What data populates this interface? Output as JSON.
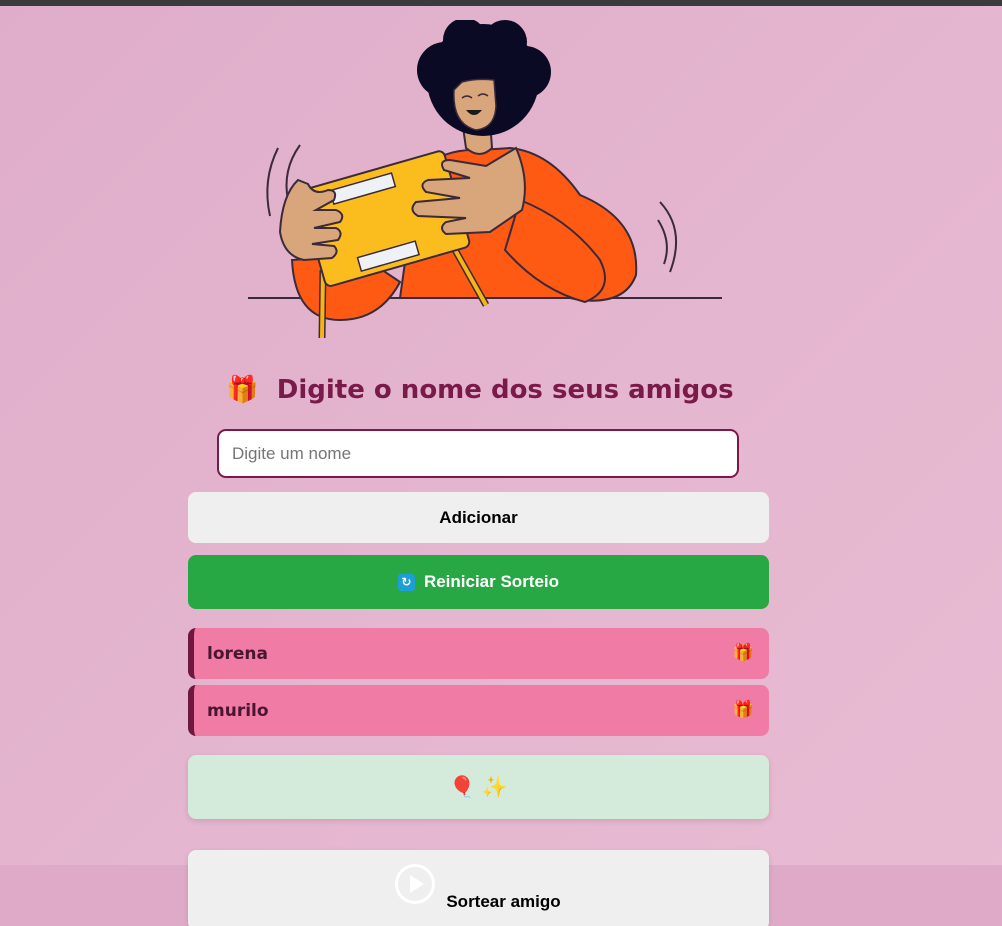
{
  "title": {
    "emoji": "🎁",
    "text": "Digite o nome dos seus amigos"
  },
  "input": {
    "placeholder": "Digite um nome",
    "value": ""
  },
  "buttons": {
    "add_label": "Adicionar",
    "reset_icon": "🔄",
    "reset_label": "Reiniciar Sorteio",
    "draw_label": "Sortear amigo",
    "draw_icon": "play-icon"
  },
  "friends": [
    {
      "name": "lorena",
      "icon": "🎁"
    },
    {
      "name": "murilo",
      "icon": "🎁"
    }
  ],
  "result": {
    "text": "🎈 ✨"
  },
  "colors": {
    "background": "#e2b0cc",
    "title": "#7a1a4a",
    "reset_button": "#28a745",
    "friend_item": "#f07ca6",
    "friend_border": "#6e1740",
    "result_box": "#d4eadb"
  },
  "illustration": "person-opening-gift"
}
